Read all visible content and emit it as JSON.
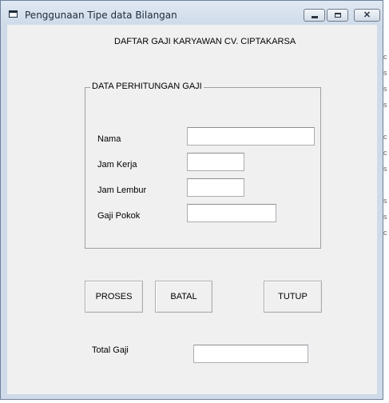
{
  "window": {
    "title": "Penggunaan Tipe data Bilangan",
    "icon": "form-icon"
  },
  "heading": "DAFTAR GAJI KARYAWAN CV. CIPTAKARSA",
  "group": {
    "legend": "DATA PERHITUNGAN GAJI",
    "fields": [
      {
        "label": "Nama",
        "value": ""
      },
      {
        "label": "Jam Kerja",
        "value": ""
      },
      {
        "label": "Jam Lembur",
        "value": ""
      },
      {
        "label": "Gaji Pokok",
        "value": ""
      }
    ]
  },
  "buttons": {
    "proses": "PROSES",
    "batal": "BATAL",
    "tutup": "TUTUP"
  },
  "total": {
    "label": "Total Gaji",
    "value": ""
  },
  "background_chars": [
    "c",
    "s",
    "s",
    "s",
    "c",
    "c",
    "s",
    "s",
    "s",
    "c"
  ],
  "colors": {
    "client_bg": "#f0f0f0",
    "frame": "#cfdbe9"
  }
}
